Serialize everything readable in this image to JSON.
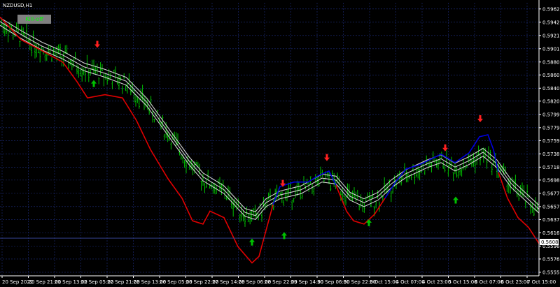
{
  "symbol_title": "NZDUSD,H1",
  "kill_button_label": "Kill-off",
  "current_price_label": "0.56082",
  "colors": {
    "background": "#000000",
    "grid": "#1e2e80",
    "price_bars": "#00c000",
    "envelope": "#d0d0d0",
    "signal_red": "#e00000",
    "signal_blue": "#0000dd",
    "arrow_up": "#00c000",
    "arrow_down": "#ff2020",
    "text": "#ffffff",
    "button_bg": "#808080",
    "button_text": "#00ff00"
  },
  "y_axis_labels": [
    "0.59625",
    "0.59420",
    "0.59215",
    "0.59010",
    "0.58805",
    "0.58605",
    "0.58400",
    "0.58200",
    "0.57995",
    "0.57790",
    "0.57590",
    "0.57385",
    "0.57180",
    "0.56980",
    "0.56775",
    "0.56570",
    "0.56370",
    "0.56165",
    "0.55960",
    "0.55760",
    "0.55555"
  ],
  "x_axis_labels": [
    "20 Sep 2022",
    "20 Sep 21:00",
    "21 Sep 13:00",
    "22 Sep 05:00",
    "22 Sep 21:00",
    "23 Sep 13:00",
    "26 Sep 05:00",
    "26 Sep 22:00",
    "27 Sep 14:00",
    "28 Sep 06:00",
    "28 Sep 22:00",
    "29 Sep 14:00",
    "30 Sep 06:00",
    "30 Sep 22:00",
    "3 Oct 15:00",
    "4 Oct 07:00",
    "4 Oct 23:00",
    "5 Oct 15:00",
    "6 Oct 07:00",
    "6 Oct 23:00",
    "7 Oct 15:00"
  ],
  "chart_data": {
    "type": "line",
    "symbol": "NZDUSD",
    "ylim": [
      0.555,
      0.5972
    ],
    "current_price": 0.56082,
    "mid_line": [
      [
        0,
        0.594
      ],
      [
        30,
        0.592
      ],
      [
        60,
        0.5902
      ],
      [
        90,
        0.5888
      ],
      [
        120,
        0.587
      ],
      [
        150,
        0.586
      ],
      [
        180,
        0.5848
      ],
      [
        210,
        0.5815
      ],
      [
        240,
        0.577
      ],
      [
        270,
        0.5725
      ],
      [
        290,
        0.57
      ],
      [
        320,
        0.568
      ],
      [
        350,
        0.5645
      ],
      [
        365,
        0.564
      ],
      [
        380,
        0.566
      ],
      [
        400,
        0.5672
      ],
      [
        430,
        0.568
      ],
      [
        460,
        0.5698
      ],
      [
        480,
        0.5695
      ],
      [
        500,
        0.567
      ],
      [
        520,
        0.566
      ],
      [
        540,
        0.567
      ],
      [
        560,
        0.569
      ],
      [
        580,
        0.5705
      ],
      [
        610,
        0.572
      ],
      [
        630,
        0.5728
      ],
      [
        650,
        0.5715
      ],
      [
        670,
        0.5725
      ],
      [
        690,
        0.5738
      ],
      [
        710,
        0.572
      ],
      [
        730,
        0.569
      ],
      [
        750,
        0.567
      ],
      [
        770,
        0.565
      ]
    ],
    "signal_red": [
      [
        0,
        0.595
      ],
      [
        30,
        0.5915
      ],
      [
        60,
        0.5898
      ],
      [
        90,
        0.588
      ],
      [
        110,
        0.585
      ],
      [
        125,
        0.5825
      ],
      [
        150,
        0.583
      ],
      [
        175,
        0.5825
      ],
      [
        195,
        0.579
      ],
      [
        215,
        0.5745
      ],
      [
        240,
        0.57
      ],
      [
        260,
        0.567
      ],
      [
        275,
        0.5635
      ],
      [
        290,
        0.563
      ],
      [
        300,
        0.565
      ],
      [
        320,
        0.564
      ],
      [
        340,
        0.5595
      ],
      [
        360,
        0.557
      ],
      [
        370,
        0.558
      ],
      [
        380,
        0.562
      ],
      [
        390,
        0.566
      ]
    ],
    "signal_blue": [
      [
        390,
        0.566
      ],
      [
        400,
        0.5688
      ],
      [
        420,
        0.5695
      ],
      [
        440,
        0.5695
      ],
      [
        455,
        0.5705
      ],
      [
        470,
        0.5712
      ],
      [
        480,
        0.569
      ]
    ],
    "signal_red_2": [
      [
        480,
        0.569
      ],
      [
        495,
        0.565
      ],
      [
        505,
        0.5635
      ],
      [
        520,
        0.563
      ],
      [
        535,
        0.5645
      ],
      [
        550,
        0.567
      ]
    ],
    "signal_blue_2": [
      [
        550,
        0.567
      ],
      [
        565,
        0.5695
      ],
      [
        580,
        0.5715
      ],
      [
        600,
        0.5722
      ],
      [
        630,
        0.5738
      ],
      [
        650,
        0.5725
      ],
      [
        670,
        0.574
      ],
      [
        685,
        0.5765
      ],
      [
        697,
        0.5768
      ],
      [
        705,
        0.5745
      ],
      [
        712,
        0.571
      ]
    ],
    "signal_red_3": [
      [
        712,
        0.571
      ],
      [
        725,
        0.567
      ],
      [
        740,
        0.564
      ],
      [
        755,
        0.5625
      ],
      [
        770,
        0.56
      ]
    ],
    "arrows_down": [
      [
        139,
        0.591
      ],
      [
        404,
        0.5695
      ],
      [
        467,
        0.5735
      ],
      [
        636,
        0.575
      ],
      [
        686,
        0.5795
      ]
    ],
    "arrows_up": [
      [
        134,
        0.5845
      ],
      [
        360,
        0.56
      ],
      [
        406,
        0.561
      ],
      [
        527,
        0.563
      ],
      [
        651,
        0.5665
      ]
    ]
  }
}
